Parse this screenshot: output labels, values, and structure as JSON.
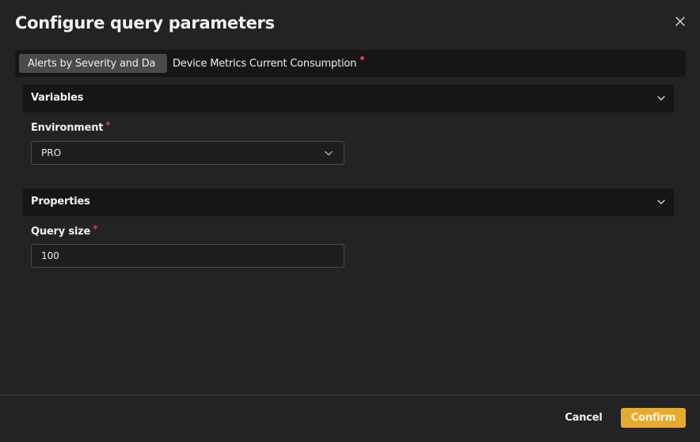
{
  "dialog": {
    "title": "Configure query parameters"
  },
  "tabs": [
    {
      "label": "Alerts by Severity and Da",
      "active": true,
      "has_error": false
    },
    {
      "label": "Device Metrics Current Consumption",
      "active": false,
      "has_error": true
    }
  ],
  "sections": {
    "variables": {
      "label": "Variables",
      "expanded": true,
      "fields": {
        "environment": {
          "label": "Environment",
          "required_mark": "*",
          "value": "PRO"
        }
      }
    },
    "properties": {
      "label": "Properties",
      "expanded": true,
      "fields": {
        "query_size": {
          "label": "Query size",
          "required_mark": "*",
          "value": "100"
        }
      }
    }
  },
  "footer": {
    "cancel_label": "Cancel",
    "confirm_label": "Confirm"
  },
  "icons": {
    "close": "close-icon",
    "chevron": "chevron-down-icon"
  },
  "colors": {
    "background": "#232323",
    "panel": "#161616",
    "accent": "#e8aa2e",
    "required": "#e23c3c",
    "active_tab": "#4a4a4a"
  }
}
